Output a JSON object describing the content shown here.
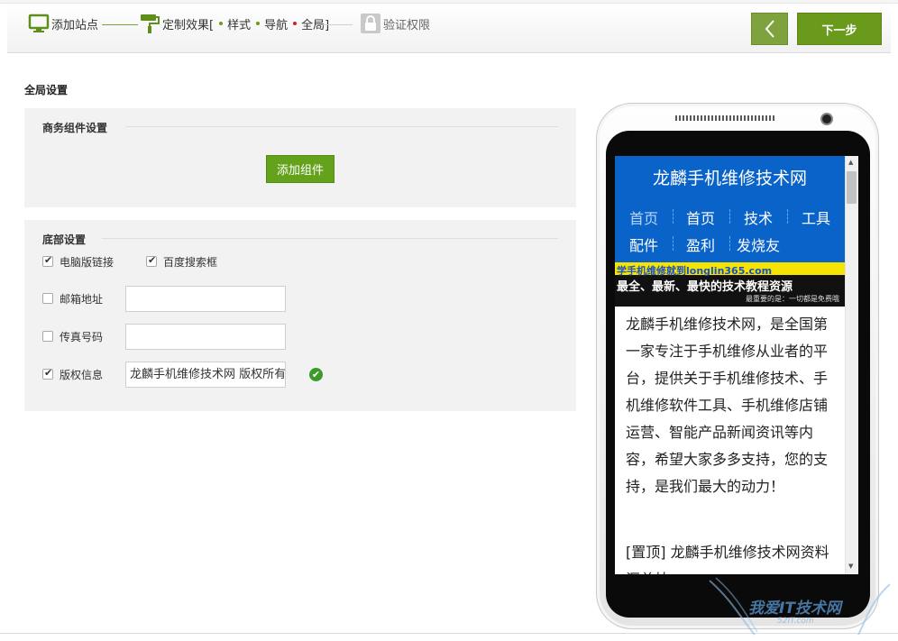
{
  "wizard": {
    "steps": [
      {
        "label": "添加站点",
        "icon": "monitor-icon"
      },
      {
        "label": "定制效果[",
        "icon": "paint-roller-icon"
      },
      {
        "label": "验证权限",
        "icon": "lock-icon"
      }
    ],
    "substeps": [
      {
        "label": "样式",
        "color": "#6a9a1c"
      },
      {
        "label": "导航",
        "color": "#6a9a1c"
      },
      {
        "label": "全局]",
        "color": "#cc2222"
      }
    ],
    "back_icon": "chevron-left-icon",
    "next_label": "下一步"
  },
  "page": {
    "title": "全局设置"
  },
  "business": {
    "heading": "商务组件设置",
    "add_label": "添加组件"
  },
  "footer": {
    "heading": "底部设置",
    "pc_link": {
      "label": "电脑版链接",
      "checked": true
    },
    "baidu_search": {
      "label": "百度搜索框",
      "checked": true
    },
    "email": {
      "label": "邮箱地址",
      "checked": false,
      "value": ""
    },
    "fax": {
      "label": "传真号码",
      "checked": false,
      "value": ""
    },
    "copyright": {
      "label": "版权信息",
      "checked": true,
      "value": "龙麟手机维修技术网 版权所有",
      "status_icon": "check-circle-icon"
    }
  },
  "preview": {
    "site_title": "龙麟手机维修技术网",
    "nav": [
      "首页",
      "首页",
      "技术",
      "工具",
      "配件",
      "盈利",
      "发烧友"
    ],
    "banner": {
      "line1": "学手机维修就到longlin365.com",
      "line2": "最全、最新、最快的技术教程资源",
      "line3": "最重要的是：一切都是免费哦"
    },
    "intro": "龙麟手机维修技术网，是全国第一家专注于手机维修从业者的平台，提供关于手机维修技术、手机维修软件工具、手机维修店铺运营、智能产品新闻资讯等内容，希望大家多多支持，您的支持，是我们最大的动力！",
    "post": "[置顶] 龙麟手机维修技术网资料汇总帖"
  },
  "watermark": {
    "text": "我爱IT技术网",
    "sub": "52IT.com"
  }
}
